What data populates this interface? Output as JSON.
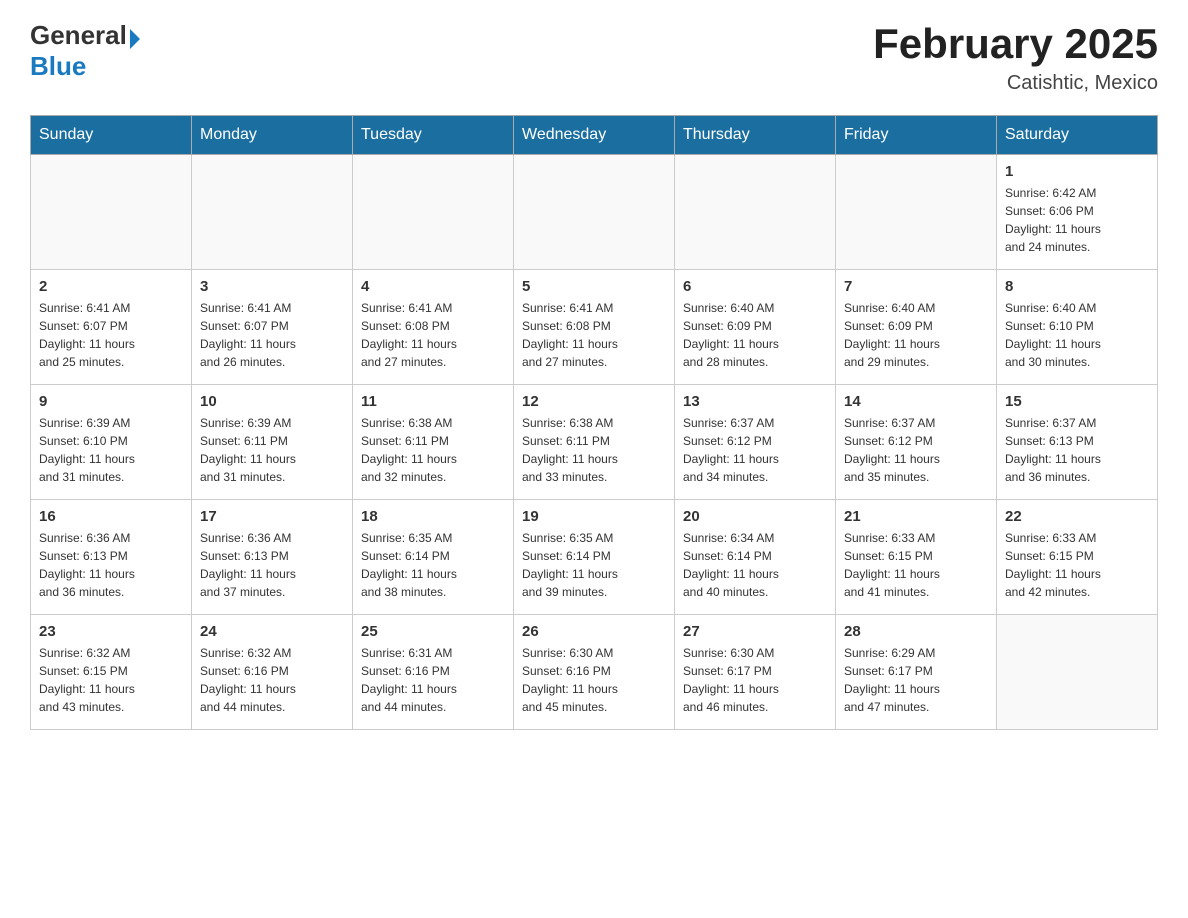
{
  "header": {
    "logo_general": "General",
    "logo_blue": "Blue",
    "title": "February 2025",
    "subtitle": "Catishtic, Mexico"
  },
  "days_of_week": [
    "Sunday",
    "Monday",
    "Tuesday",
    "Wednesday",
    "Thursday",
    "Friday",
    "Saturday"
  ],
  "weeks": [
    [
      {
        "day": "",
        "info": ""
      },
      {
        "day": "",
        "info": ""
      },
      {
        "day": "",
        "info": ""
      },
      {
        "day": "",
        "info": ""
      },
      {
        "day": "",
        "info": ""
      },
      {
        "day": "",
        "info": ""
      },
      {
        "day": "1",
        "info": "Sunrise: 6:42 AM\nSunset: 6:06 PM\nDaylight: 11 hours\nand 24 minutes."
      }
    ],
    [
      {
        "day": "2",
        "info": "Sunrise: 6:41 AM\nSunset: 6:07 PM\nDaylight: 11 hours\nand 25 minutes."
      },
      {
        "day": "3",
        "info": "Sunrise: 6:41 AM\nSunset: 6:07 PM\nDaylight: 11 hours\nand 26 minutes."
      },
      {
        "day": "4",
        "info": "Sunrise: 6:41 AM\nSunset: 6:08 PM\nDaylight: 11 hours\nand 27 minutes."
      },
      {
        "day": "5",
        "info": "Sunrise: 6:41 AM\nSunset: 6:08 PM\nDaylight: 11 hours\nand 27 minutes."
      },
      {
        "day": "6",
        "info": "Sunrise: 6:40 AM\nSunset: 6:09 PM\nDaylight: 11 hours\nand 28 minutes."
      },
      {
        "day": "7",
        "info": "Sunrise: 6:40 AM\nSunset: 6:09 PM\nDaylight: 11 hours\nand 29 minutes."
      },
      {
        "day": "8",
        "info": "Sunrise: 6:40 AM\nSunset: 6:10 PM\nDaylight: 11 hours\nand 30 minutes."
      }
    ],
    [
      {
        "day": "9",
        "info": "Sunrise: 6:39 AM\nSunset: 6:10 PM\nDaylight: 11 hours\nand 31 minutes."
      },
      {
        "day": "10",
        "info": "Sunrise: 6:39 AM\nSunset: 6:11 PM\nDaylight: 11 hours\nand 31 minutes."
      },
      {
        "day": "11",
        "info": "Sunrise: 6:38 AM\nSunset: 6:11 PM\nDaylight: 11 hours\nand 32 minutes."
      },
      {
        "day": "12",
        "info": "Sunrise: 6:38 AM\nSunset: 6:11 PM\nDaylight: 11 hours\nand 33 minutes."
      },
      {
        "day": "13",
        "info": "Sunrise: 6:37 AM\nSunset: 6:12 PM\nDaylight: 11 hours\nand 34 minutes."
      },
      {
        "day": "14",
        "info": "Sunrise: 6:37 AM\nSunset: 6:12 PM\nDaylight: 11 hours\nand 35 minutes."
      },
      {
        "day": "15",
        "info": "Sunrise: 6:37 AM\nSunset: 6:13 PM\nDaylight: 11 hours\nand 36 minutes."
      }
    ],
    [
      {
        "day": "16",
        "info": "Sunrise: 6:36 AM\nSunset: 6:13 PM\nDaylight: 11 hours\nand 36 minutes."
      },
      {
        "day": "17",
        "info": "Sunrise: 6:36 AM\nSunset: 6:13 PM\nDaylight: 11 hours\nand 37 minutes."
      },
      {
        "day": "18",
        "info": "Sunrise: 6:35 AM\nSunset: 6:14 PM\nDaylight: 11 hours\nand 38 minutes."
      },
      {
        "day": "19",
        "info": "Sunrise: 6:35 AM\nSunset: 6:14 PM\nDaylight: 11 hours\nand 39 minutes."
      },
      {
        "day": "20",
        "info": "Sunrise: 6:34 AM\nSunset: 6:14 PM\nDaylight: 11 hours\nand 40 minutes."
      },
      {
        "day": "21",
        "info": "Sunrise: 6:33 AM\nSunset: 6:15 PM\nDaylight: 11 hours\nand 41 minutes."
      },
      {
        "day": "22",
        "info": "Sunrise: 6:33 AM\nSunset: 6:15 PM\nDaylight: 11 hours\nand 42 minutes."
      }
    ],
    [
      {
        "day": "23",
        "info": "Sunrise: 6:32 AM\nSunset: 6:15 PM\nDaylight: 11 hours\nand 43 minutes."
      },
      {
        "day": "24",
        "info": "Sunrise: 6:32 AM\nSunset: 6:16 PM\nDaylight: 11 hours\nand 44 minutes."
      },
      {
        "day": "25",
        "info": "Sunrise: 6:31 AM\nSunset: 6:16 PM\nDaylight: 11 hours\nand 44 minutes."
      },
      {
        "day": "26",
        "info": "Sunrise: 6:30 AM\nSunset: 6:16 PM\nDaylight: 11 hours\nand 45 minutes."
      },
      {
        "day": "27",
        "info": "Sunrise: 6:30 AM\nSunset: 6:17 PM\nDaylight: 11 hours\nand 46 minutes."
      },
      {
        "day": "28",
        "info": "Sunrise: 6:29 AM\nSunset: 6:17 PM\nDaylight: 11 hours\nand 47 minutes."
      },
      {
        "day": "",
        "info": ""
      }
    ]
  ]
}
